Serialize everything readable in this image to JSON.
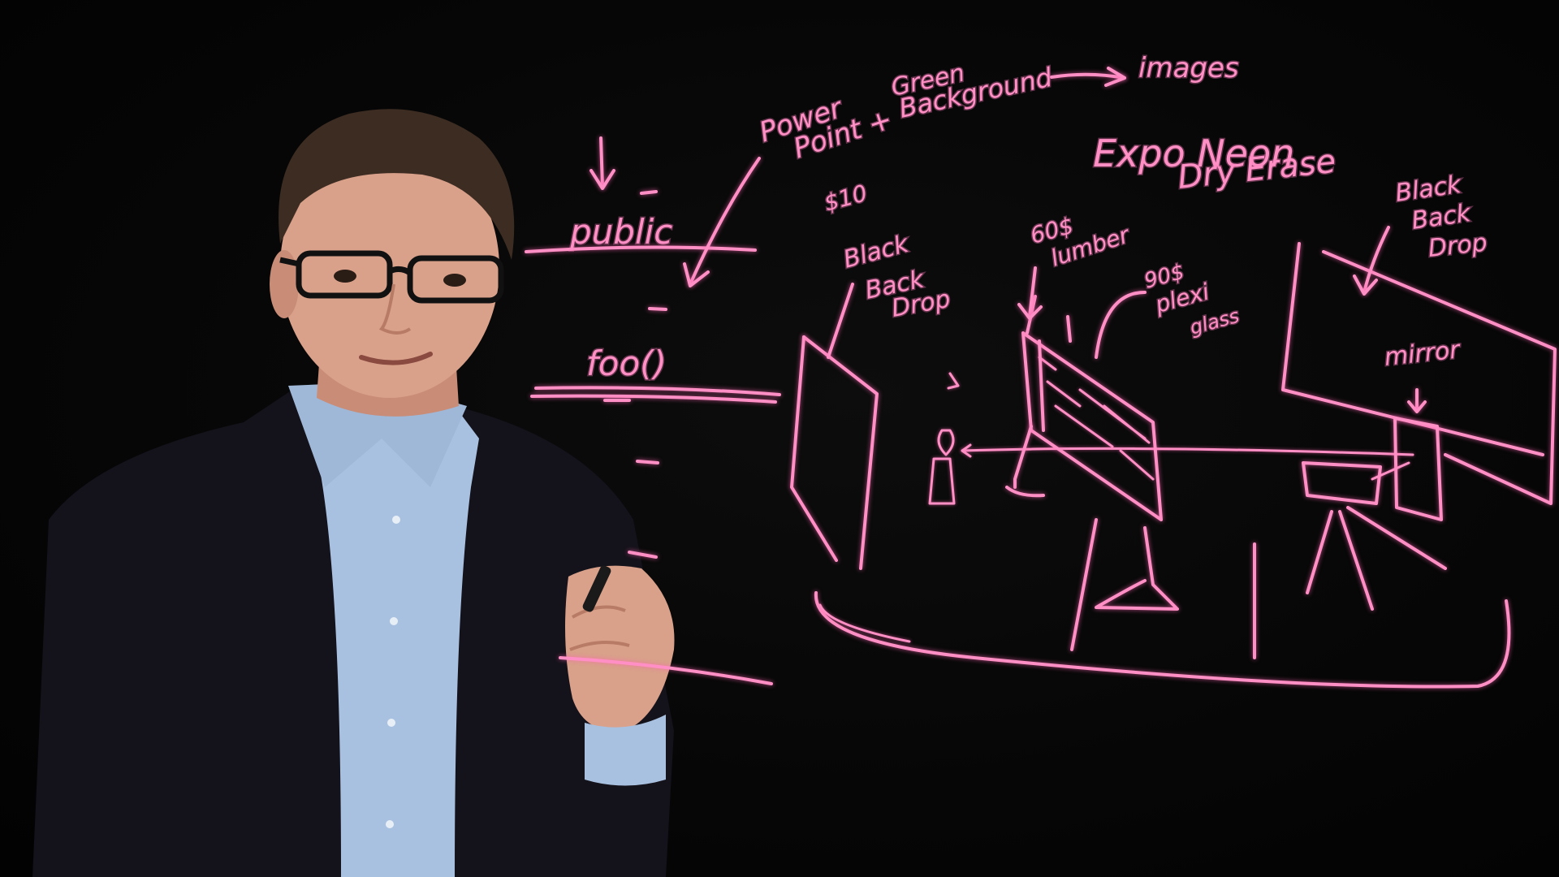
{
  "colors": {
    "background": "#050505",
    "ink": "#ff8fc4",
    "jacket": "#14121a",
    "shirt": "#a9c1e0",
    "skin": "#d9a08a",
    "hair": "#3d2c22"
  },
  "board": {
    "top_note": {
      "line1": "Power",
      "line2": "Point +",
      "line3": "Green",
      "line4": "Background",
      "arrow_target": "images"
    },
    "marker_title": {
      "line1": "Expo Neon",
      "line2": "Dry Erase"
    },
    "code": {
      "keyword": "public",
      "method": "foo()"
    },
    "left_backdrop": {
      "price": "$10",
      "line1": "Black",
      "line2": "Back",
      "line3": "Drop"
    },
    "lumber": {
      "price": "60$",
      "label": "lumber"
    },
    "plexi": {
      "price": "90$",
      "line1": "plexi",
      "line2": "glass"
    },
    "right_backdrop": {
      "line1": "Black",
      "line2": "Back",
      "line3": "Drop"
    },
    "mirror_label": "mirror"
  },
  "presenter": {
    "description_icon": "person-presenter"
  }
}
